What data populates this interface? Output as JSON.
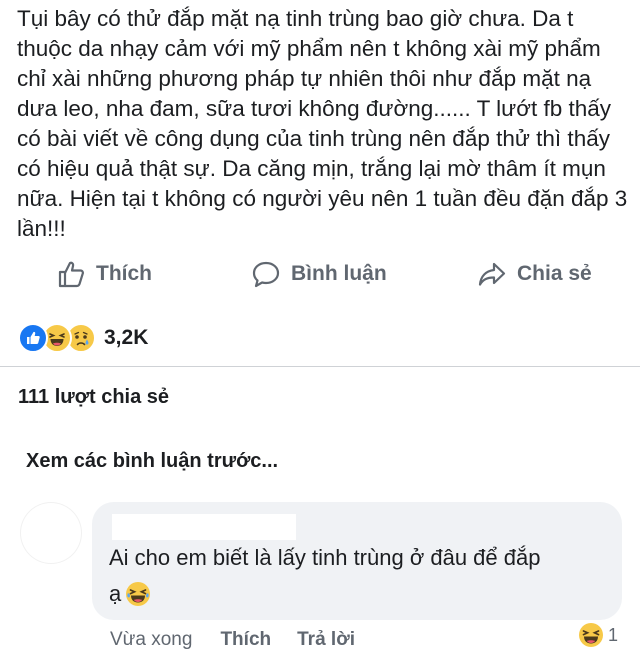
{
  "post": {
    "text": "Tụi bây có thử đắp mặt nạ tinh trùng bao giờ chưa. Da t\nthuộc da nhạy cảm với mỹ phẩm nên t không xài mỹ phẩm\nchỉ xài những phương pháp tự nhiên thôi như đắp mặt nạ\ndưa leo, nha đam, sữa tươi không đường...... T lướt fb thấy\ncó bài viết về công dụng của tinh trùng nên đắp thử thì thấy\ncó hiệu quả thật sự. Da căng mịn, trắng lại mờ thâm ít mụn\nnữa. Hiện tại t không có người yêu nên 1 tuần đều đặn đắp 3\nlần!!!"
  },
  "actions": {
    "like_label": "Thích",
    "comment_label": "Bình luận",
    "share_label": "Chia sẻ"
  },
  "reactions": {
    "icons": [
      "like-reaction-icon",
      "haha-reaction-icon",
      "sad-reaction-icon"
    ],
    "count": "3,2K"
  },
  "shares": {
    "text": "111 lượt chia sẻ"
  },
  "comments": {
    "view_previous": "Xem các bình luận trước...",
    "items": [
      {
        "text": "Ai cho em biết là lấy tinh trùng ở đâu để đắp\nạ",
        "emoji": "haha-emoji-icon",
        "time": "Vừa xong",
        "like_label": "Thích",
        "reply_label": "Trả lời",
        "reaction_icon": "haha-reaction-icon",
        "reaction_count": "1"
      }
    ]
  },
  "colors": {
    "text": "#1c1e21",
    "secondary": "#606770",
    "like_blue": "#1877f2",
    "haha_yellow": "#f7c948",
    "bubble_bg": "#f0f2f5"
  }
}
